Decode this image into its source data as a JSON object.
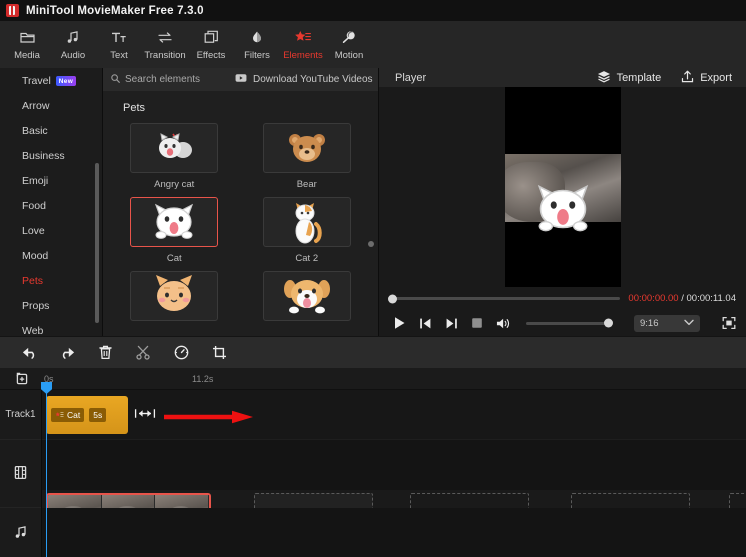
{
  "window": {
    "title": "MiniTool MovieMaker Free 7.3.0",
    "logo_icon": "minitool-logo-icon"
  },
  "toolbar_tabs": [
    {
      "label": "Media",
      "icon": "media-folder-icon",
      "active": false
    },
    {
      "label": "Audio",
      "icon": "music-note-icon",
      "active": false
    },
    {
      "label": "Text",
      "icon": "text-tt-icon",
      "active": false
    },
    {
      "label": "Transition",
      "icon": "transition-arrows-icon",
      "active": false
    },
    {
      "label": "Effects",
      "icon": "effects-layers-icon",
      "active": false
    },
    {
      "label": "Filters",
      "icon": "filters-droplet-icon",
      "active": false
    },
    {
      "label": "Elements",
      "icon": "elements-star-icon",
      "active": true
    },
    {
      "label": "Motion",
      "icon": "motion-comet-icon",
      "active": false
    }
  ],
  "categories": [
    {
      "label": "Travel",
      "badge": "New",
      "active": false
    },
    {
      "label": "Arrow",
      "badge": "",
      "active": false
    },
    {
      "label": "Basic",
      "badge": "",
      "active": false
    },
    {
      "label": "Business",
      "badge": "",
      "active": false
    },
    {
      "label": "Emoji",
      "badge": "",
      "active": false
    },
    {
      "label": "Food",
      "badge": "",
      "active": false
    },
    {
      "label": "Love",
      "badge": "",
      "active": false
    },
    {
      "label": "Mood",
      "badge": "",
      "active": false
    },
    {
      "label": "Pets",
      "badge": "",
      "active": true
    },
    {
      "label": "Props",
      "badge": "",
      "active": false
    },
    {
      "label": "Web",
      "badge": "",
      "active": false
    }
  ],
  "elements_panel": {
    "search_placeholder": "Search elements",
    "search_value": "",
    "search_icon": "search-icon",
    "download_label": "Download YouTube Videos",
    "download_icon": "youtube-download-icon",
    "section_title": "Pets",
    "items": [
      {
        "name": "Angry cat",
        "selected": false,
        "art": "angry-cat"
      },
      {
        "name": "Bear",
        "selected": false,
        "art": "bear"
      },
      {
        "name": "Cat",
        "selected": true,
        "art": "cat"
      },
      {
        "name": "Cat 2",
        "selected": false,
        "art": "cat2"
      },
      {
        "name": "",
        "selected": false,
        "art": "cat3"
      },
      {
        "name": "",
        "selected": false,
        "art": "dog"
      }
    ]
  },
  "player": {
    "title": "Player",
    "template_label": "Template",
    "template_icon": "layers-icon",
    "export_label": "Export",
    "export_icon": "export-upload-icon",
    "current_time": "00:00:00.00",
    "separator": " / ",
    "total_time": "00:00:11.04",
    "aspect_ratio": "9:16",
    "aspect_ratio_icon": "chevron-down-icon",
    "fullscreen_icon": "fullscreen-icon",
    "controls": [
      {
        "icon": "play-icon",
        "name": "play-button"
      },
      {
        "icon": "prev-frame-icon",
        "name": "previous-frame-button"
      },
      {
        "icon": "next-frame-icon",
        "name": "next-frame-button"
      },
      {
        "icon": "stop-icon",
        "name": "stop-button"
      },
      {
        "icon": "volume-icon",
        "name": "volume-button"
      }
    ],
    "seek_percent": 0,
    "volume_percent": 100
  },
  "edit_toolbar": [
    {
      "icon": "undo-icon",
      "name": "undo-button"
    },
    {
      "icon": "redo-icon",
      "name": "redo-button"
    },
    {
      "icon": "delete-icon",
      "name": "delete-button"
    },
    {
      "icon": "split-scissors-icon",
      "name": "split-button"
    },
    {
      "icon": "speed-gauge-icon",
      "name": "speed-button"
    },
    {
      "icon": "crop-icon",
      "name": "crop-button"
    }
  ],
  "timeline": {
    "add_media_icon": "add-media-icon",
    "ruler_start": "0s",
    "ruler_end": "11.2s",
    "tracks": [
      {
        "label": "Track1",
        "icon": ""
      },
      {
        "label": "",
        "icon": "film-strip-icon"
      },
      {
        "label": "",
        "icon": "music-note-icon"
      }
    ],
    "sticker_clip": {
      "label": "Cat",
      "duration": "5s",
      "star_icon": "element-star-icon",
      "drag_handle_icon": "resize-handle-icon"
    },
    "video_clip": {
      "audio_icon": "speaker-icon"
    },
    "transition_icon": "transition-swap-icon",
    "import_icon": "import-media-icon",
    "annotation_arrow": "red-arrow-annotation"
  },
  "colors": {
    "accent_red": "#e8392f",
    "sticker_clip": "#e9a723",
    "selection_border": "#e8544a",
    "playhead": "#2a9df4",
    "audio_bar": "#2e4a6b"
  }
}
